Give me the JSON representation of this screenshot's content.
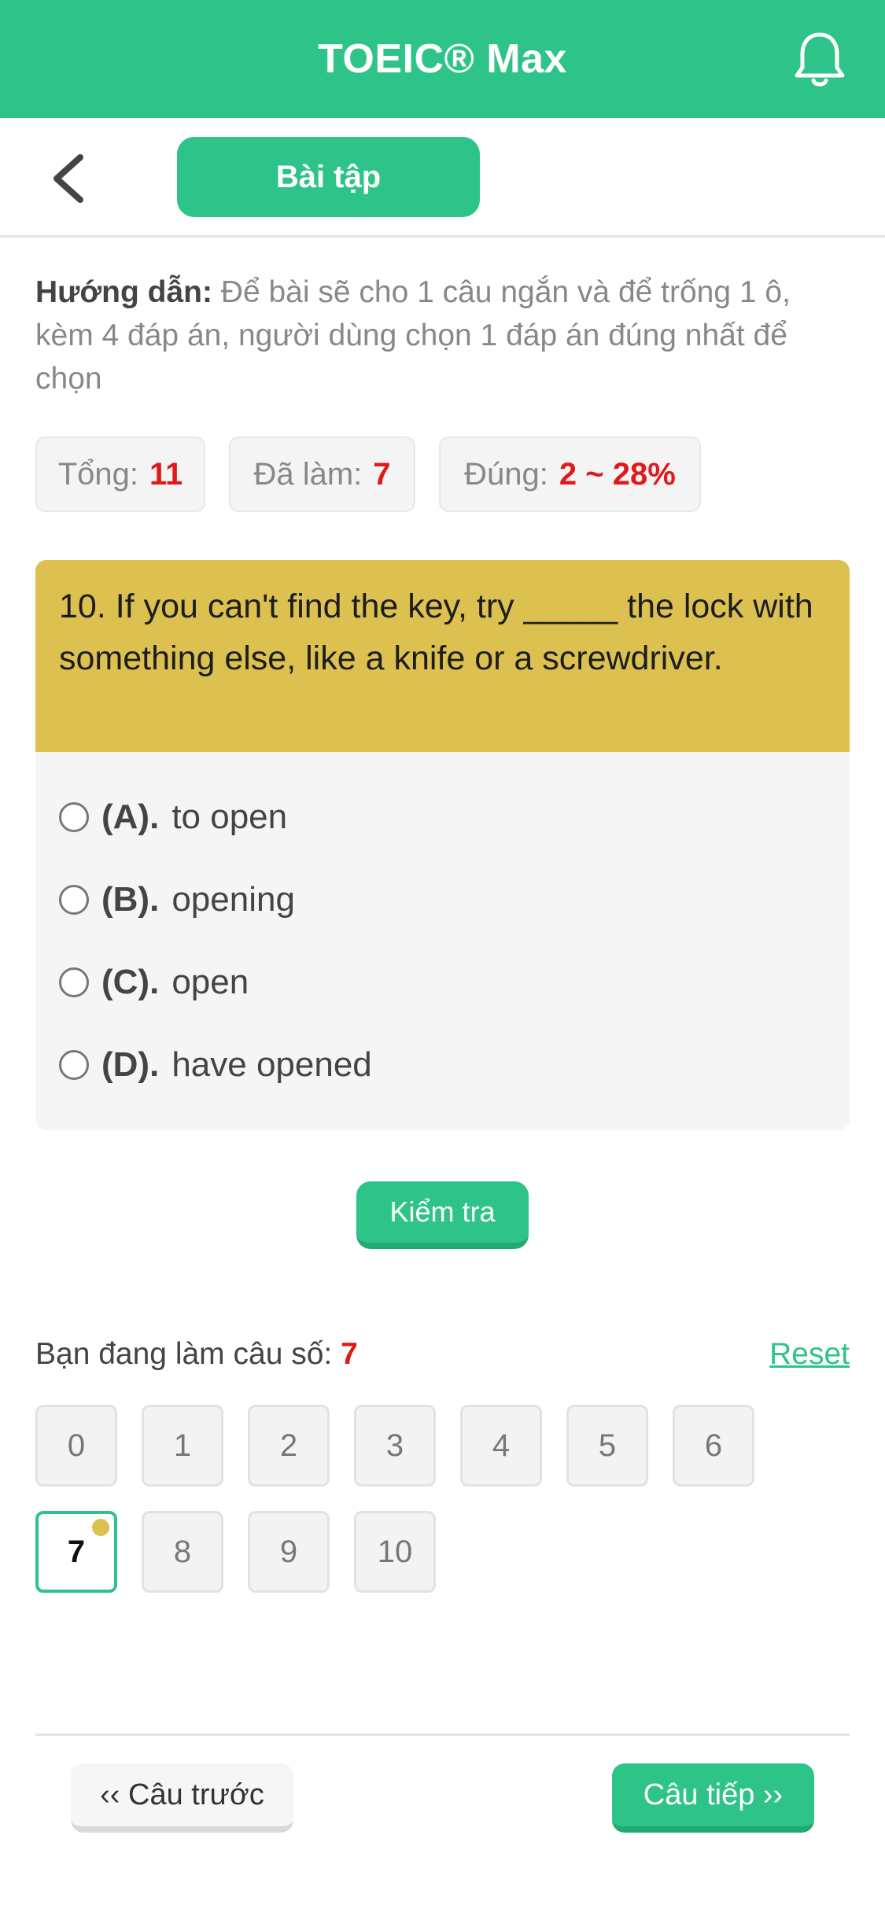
{
  "header": {
    "title": "TOEIC® Max",
    "bell_icon": "bell-icon"
  },
  "subbar": {
    "back_icon": "chevron-left-icon",
    "tab_label": "Bài tập"
  },
  "guide": {
    "label": "Hướng dẫn:",
    "text": "Để bài sẽ cho 1 câu ngắn và để trống 1 ô, kèm 4 đáp án, người dùng chọn 1 đáp án đúng nhất để chọn"
  },
  "stats": {
    "total_label": "Tổng:",
    "total_value": "11",
    "done_label": "Đã làm:",
    "done_value": "7",
    "correct_label": "Đúng:",
    "correct_value": "2 ~ 28%"
  },
  "question": {
    "text": "10. If you can't find the key, try _____ the lock with something else, like a knife or a screwdriver.",
    "options": [
      {
        "label": "(A).",
        "text": "to open"
      },
      {
        "label": "(B).",
        "text": "opening"
      },
      {
        "label": "(C).",
        "text": "open"
      },
      {
        "label": "(D).",
        "text": "have opened"
      }
    ]
  },
  "check_button": "Kiểm tra",
  "progress": {
    "label": "Bạn đang làm câu số:",
    "current": "7",
    "reset": "Reset"
  },
  "question_numbers": [
    "0",
    "1",
    "2",
    "3",
    "4",
    "5",
    "6",
    "7",
    "8",
    "9",
    "10"
  ],
  "navigation": {
    "prev": "‹‹ Câu trước",
    "next": "Câu tiếp ››"
  },
  "colors": {
    "primary": "#2ec489",
    "question_bg": "#dcc050",
    "highlight": "#e0191b"
  }
}
